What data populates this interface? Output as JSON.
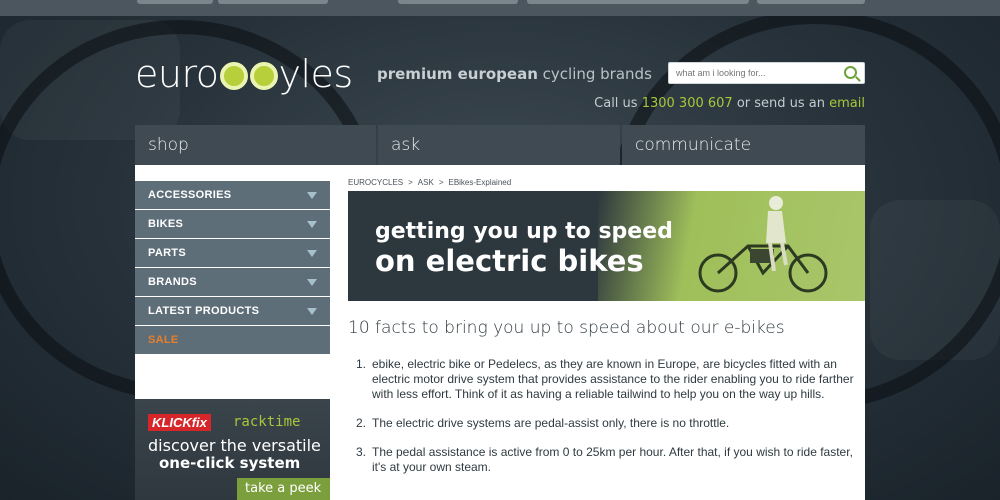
{
  "header": {
    "logo": {
      "part1": "euro",
      "part2": "y",
      "part3": "les"
    },
    "tagline": {
      "bold": "premium european",
      "rest": " cycling brands"
    },
    "search": {
      "placeholder": "what am i looking for..."
    },
    "contact": {
      "prefix": "Call us ",
      "phone": "1300 300 607",
      "middle": " or send us an ",
      "email": "email"
    }
  },
  "nav": {
    "items": [
      "shop",
      "ask",
      "communicate"
    ]
  },
  "sidebar": {
    "items": [
      "ACCESSORIES",
      "BIKES",
      "PARTS",
      "BRANDS",
      "LATEST PRODUCTS"
    ],
    "sale": "SALE"
  },
  "ad": {
    "brand1": "KLICKfix",
    "brand2": "racktime",
    "line1": "discover the versatile",
    "line2": "one-click system",
    "cta": "take a peek"
  },
  "breadcrumb": [
    "EUROCYCLES",
    ">",
    "ASK",
    ">",
    "EBikes-Explained"
  ],
  "hero": {
    "line1": "getting you up to speed",
    "line2": "on electric bikes"
  },
  "article": {
    "title": "10 facts to bring you up to speed about our e-bikes",
    "facts": [
      {
        "num": "1.",
        "text": "ebike, electric bike or Pedelecs, as they are known in Europe, are bicycles fitted with an electric motor drive system that provides assistance to the rider enabling you to ride farther with less effort. Think of it as having a reliable tailwind to help you on the way up hills."
      },
      {
        "num": "2.",
        "text": "The electric drive systems are pedal-assist only, there is no throttle."
      },
      {
        "num": "3.",
        "text": "The pedal assistance is active from 0 to 25km per hour. After that, if you wish to ride faster, it's at your own steam."
      }
    ]
  },
  "colors": {
    "accent": "#a6c83a",
    "sale": "#e67f2c",
    "sidebar": "#5e6e78",
    "nav": "#3f4a52"
  }
}
